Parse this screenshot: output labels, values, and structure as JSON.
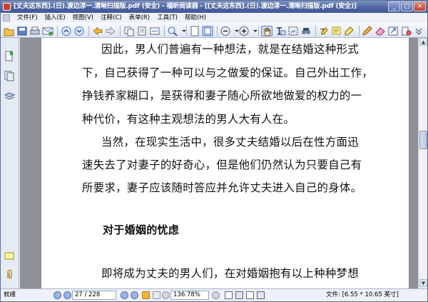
{
  "window": {
    "title": "[丈夫这东西].(日).渡边淳一.清晰扫描版.pdf (安全) - 福昕阅读器 - [[丈夫这东西].(日).渡边淳一.清晰扫描版.pdf (安全)]",
    "controls": {
      "minimize": "_",
      "maximize": "□",
      "close": "×"
    }
  },
  "menu": {
    "items": [
      "文件(F)",
      "插入(E)",
      "视图(V)",
      "注释(C)",
      "表单(R)",
      "工具(T)",
      "帮助(H)"
    ]
  },
  "toolbar": {
    "icons": [
      "open-icon",
      "save-icon",
      "print-icon",
      "email-icon",
      "prev-page-icon",
      "next-page-icon",
      "back-icon",
      "forward-icon",
      "copy-icon",
      "fit-page-icon",
      "zoom-icon",
      "single-page-icon",
      "facing-page-icon",
      "zoom-out-icon",
      "zoom-in-icon",
      "hand-tool-icon",
      "select-text-icon",
      "snapshot-icon",
      "find-icon",
      "typewriter-icon",
      "note-icon",
      "highlight-icon",
      "pencil-icon",
      "eraser-icon",
      "link-icon",
      "stamp-icon"
    ]
  },
  "document": {
    "lines": [
      "因此，男人们普遍有一种想法，就是在结婚这种形式",
      "下，自己获得了一种可以与之做爱的保证。自己外出工作，",
      "挣钱养家糊口，是获得和妻子随心所欲地做爱的权力的一",
      "种代价，有这种主观想法的男人大有人在。",
      "当然，在现实生活中，很多丈夫结婚以后在性方面迅",
      "速失去了对妻子的好奇心，但是他们仍然认为只要自己有",
      "所要求，妻子应该随时答应并允许丈夫进入自己的身体。",
      "对于婚姻的忧虑",
      "即将成为丈夫的男人们，在对婚姻抱有以上种种梦想"
    ]
  },
  "status": {
    "ready": "就绪",
    "page_display": "27 / 228",
    "zoom": "136.78%",
    "doc_info": "文件: [6.55 * 10.65 英寸]"
  }
}
